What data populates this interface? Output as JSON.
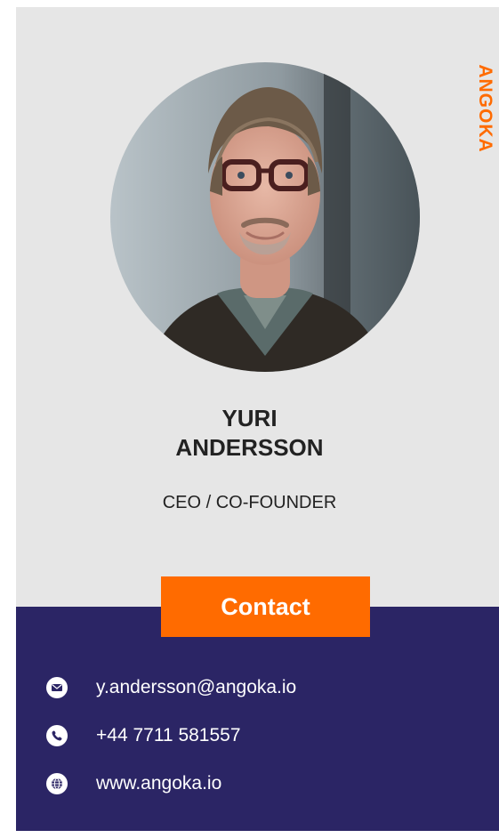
{
  "brand": {
    "name": "ANGOKA",
    "color": "#ff6b00"
  },
  "profile": {
    "first_name": "YURI",
    "last_name": "ANDERSSON",
    "role": "CEO / CO-FOUNDER",
    "photo_alt": "Portrait of Yuri Andersson"
  },
  "contact": {
    "button_label": "Contact",
    "email": "y.andersson@angoka.io",
    "phone": "+44 7711 581557",
    "website": "www.angoka.io"
  },
  "icons": {
    "email": "envelope-icon",
    "phone": "phone-icon",
    "website": "globe-icon"
  },
  "colors": {
    "top_background": "#e6e6e6",
    "bottom_background": "#2b2565",
    "accent": "#ff6b00"
  }
}
